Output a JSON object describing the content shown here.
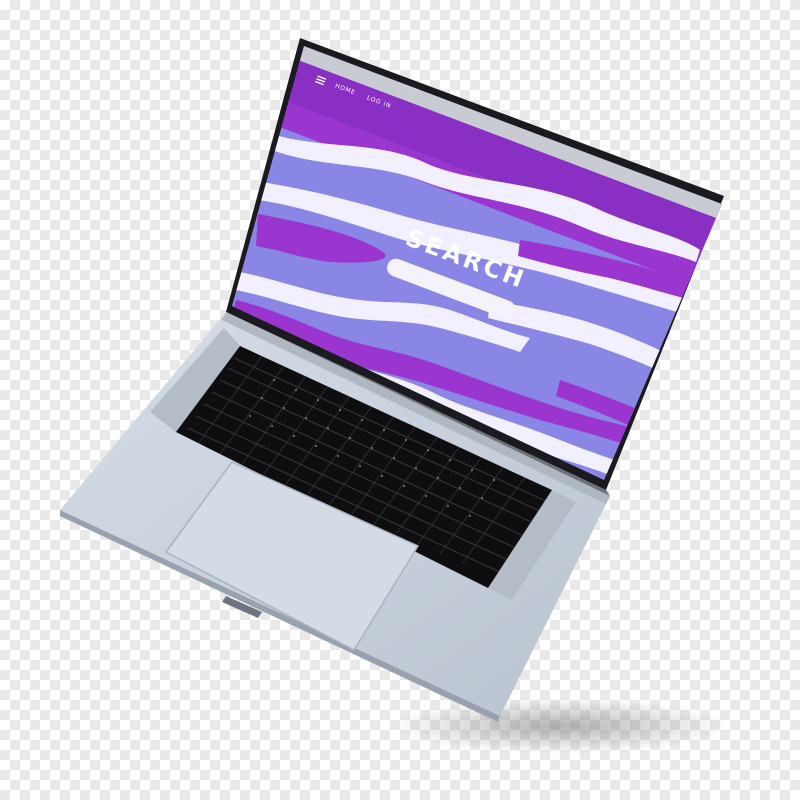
{
  "nav": {
    "menu_icon": "hamburger-menu-icon",
    "home_label": "HOME",
    "login_label": "LOG IN"
  },
  "hero": {
    "title": "SEARCH",
    "search_placeholder": ""
  },
  "colors": {
    "primary_purple": "#8a2fc4",
    "wave_lavender": "#8a86e6",
    "wave_white": "#f2f0ff",
    "laptop_silver": "#c7d1dc",
    "keyboard_black": "#161616"
  }
}
